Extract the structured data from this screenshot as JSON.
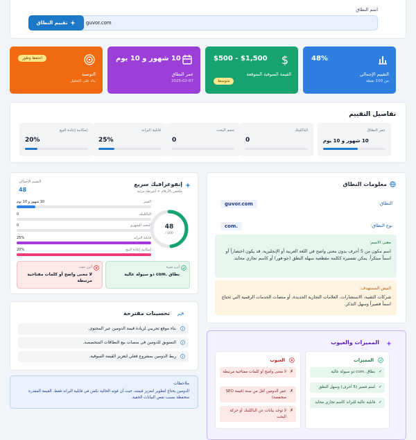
{
  "form": {
    "label": "اسم النطاق",
    "value": "guvor.com",
    "button_label": "تقييم النطاق"
  },
  "tiles": {
    "rating": {
      "value": "48%",
      "title": "التقييم الإجمالي",
      "sub": "من 100 نقطة",
      "color": "#2f7fe0"
    },
    "value": {
      "value": "$1,500 - $500",
      "title": "القيمة السوقية المتوقعة",
      "badge": "متوسط",
      "color": "#16a36f"
    },
    "age": {
      "value": "10 شهور و 10 يوم",
      "title": "عمر النطاق",
      "sub": "2025-02-07",
      "color": "#9b3fd9"
    },
    "recommendation": {
      "title": "التوصية",
      "sub": "بناء على التحليل",
      "badge": "احتفظ وطور",
      "color": "#ef6a10"
    }
  },
  "details": {
    "title": "تفاصيل التقييم",
    "metrics": [
      {
        "label": "عمر النطاق",
        "value": "10 شهور و 10 يوم",
        "fill": 0.55
      },
      {
        "label": "الباكلينك",
        "value": "0",
        "fill": 0
      },
      {
        "label": "حجم البحث",
        "value": "0",
        "fill": 0
      },
      {
        "label": "قابلية البراند",
        "value": "25%",
        "fill": 0.25
      },
      {
        "label": "إمكانية إعادة البيع",
        "value": "20%",
        "fill": 0.2
      }
    ]
  },
  "info": {
    "title": "معلومات النطاق",
    "domain_label": "النطاق:",
    "domain_value": "guvor.com",
    "type_label": "نوع النطاق:",
    "type_value": ".com",
    "meaning_label": "معنى الاسم:",
    "meaning_text": "اسم مكون من 5 أحرف بدون معنى واضح في اللغة العربية أو الإنجليزية. قد يكون اختصاراً أو اسماً مبتكراً. يمكن تفسيره ككلمة مقطعية سهلة النطق (جو-فور) أو كاسم تجاري محايد.",
    "niche_label": "النيش المستهدف:",
    "niche_text": "شركات التقنية، الاستشارات، العلامات التجارية الجديدة، أو منصات الخدمات الرقمية التي تحتاج اسماً قصيراً وسهل التذكر."
  },
  "infographic": {
    "title": "إنفوغرافيك سريع",
    "subtitle": "ملخص بالأرقام + أشرطة مرئية",
    "total_label": "التقييم الإجمالي",
    "total_value": "48",
    "bars": [
      {
        "label": "العمر",
        "value": "10 شهور و 10 يوم",
        "fill": 0.14,
        "color": "#2f7fe0"
      },
      {
        "label": "الباكلينك",
        "value": "0",
        "fill": 0,
        "color": "#16a36f"
      },
      {
        "label": "البحث الشهري",
        "value": "0",
        "fill": 0,
        "color": "#16a36f"
      },
      {
        "label": "قابلية البراند",
        "value": "25%",
        "fill": 1.0,
        "color": "#a43ad9"
      },
      {
        "label": "إمكانية إعادة البيع",
        "value": "20%",
        "fill": 1.0,
        "color": "#ec3b7a"
      }
    ],
    "gauge_value": "48",
    "gauge_sub": "100 /",
    "gauge_fill": 0.48,
    "strength_label": "أبرز ميزة",
    "strength_text": "نطاق .com ذو سيولة عالية",
    "weakness_label": "أبرز عيب",
    "weakness_text": "لا معنى واضح أو كلمات مفتاحية مرتبطة"
  },
  "improvements": {
    "title": "تحسينات مقترحة",
    "items": [
      "بناء موقع تجريبي لزيادة قيمة الدومين عبر المحتوى.",
      "التسويق للدومين في منصات بيع النطاقات المتخصصة.",
      "ربط الدومين بمشروع فعلي لتعزيز القيمة السوقية."
    ]
  },
  "notes": {
    "title": "ملاحظات",
    "text": "الدومين يحتاج لتطوير لتعزيز قيمته، حيث أن قوته الحالية تكمن في قابلية البراند فقط. القيمة المقدرة متحفظة بسبب نقص البيانات الخفية."
  },
  "pros_cons": {
    "title": "المميزات والعيوب",
    "pros_title": "المميزات",
    "pros": [
      "نطاق .com ذو سيولة عالية",
      "اسم قصير (5 أحرف) وسهل النطق",
      "قابلية عالية للبراند كاسم تجاري محايد"
    ],
    "cons_title": "العيوب",
    "cons": [
      "لا معنى واضح أو كلمات مفتاحية مرتبطة",
      "عمر الدومين أقل من سنة (قيمة SEO منخفضة)",
      "لا توجد بيانات عن الباكلينك أو حركة البحث"
    ]
  }
}
